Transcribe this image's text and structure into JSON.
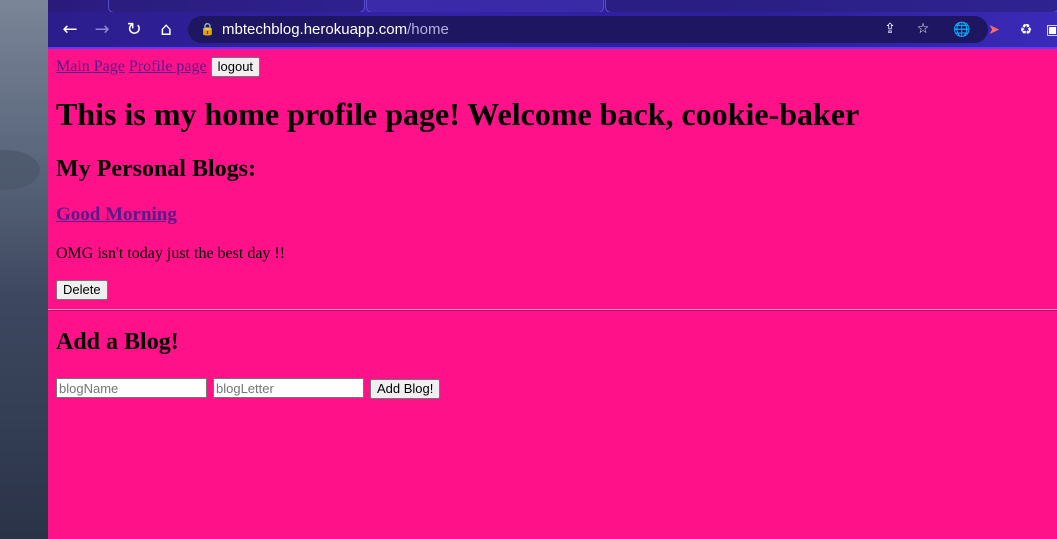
{
  "browser": {
    "url_host": "mbtechblog.herokuapp.com",
    "url_path": "/home",
    "back_icon": "arrow-left-icon",
    "forward_icon": "arrow-right-icon",
    "reload_icon": "reload-icon",
    "home_icon": "home-icon"
  },
  "nav": {
    "main_page": "Main Page",
    "profile_page": "Profile page",
    "logout": "logout"
  },
  "page": {
    "heading": "This is my home profile page! Welcome back, cookie-baker",
    "blogs_heading": "My Personal Blogs:"
  },
  "blogs": [
    {
      "title": "Good Morning",
      "text": "OMG isn't today just the best day !!",
      "delete_label": "Delete"
    }
  ],
  "add_blog": {
    "heading": "Add a Blog!",
    "name_placeholder": "blogName",
    "letter_placeholder": "blogLetter",
    "submit_label": "Add Blog!"
  },
  "colors": {
    "page_background": "#ff1289",
    "link": "#551a8b"
  }
}
